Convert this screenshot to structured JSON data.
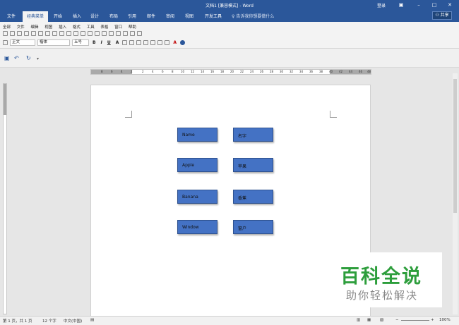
{
  "window": {
    "title": "文档1 [兼容模式] - Word",
    "login": "登录"
  },
  "tabs": [
    "文件",
    "经典菜单",
    "开始",
    "插入",
    "设计",
    "布局",
    "引用",
    "邮件",
    "审阅",
    "视图",
    "开发工具"
  ],
  "tellme": "告诉我你想要做什么",
  "share": "共享",
  "menu": [
    "全部",
    "文件",
    "编辑",
    "视图",
    "插入",
    "格式",
    "工具",
    "表格",
    "窗口",
    "帮助"
  ],
  "toolbar": {
    "style": "正文",
    "font": "楷体",
    "size": "五号",
    "style_alt": "正文"
  },
  "ruler": {
    "left_ticks": [
      "8",
      "6",
      "4",
      "2"
    ],
    "right_ticks": [
      "2",
      "4",
      "6",
      "8",
      "10",
      "12",
      "14",
      "16",
      "18",
      "20",
      "22",
      "24",
      "26",
      "28",
      "30",
      "32",
      "34",
      "36",
      "38",
      "40",
      "42",
      "44",
      "46",
      "48"
    ]
  },
  "boxes": [
    {
      "left": "Name",
      "right": "名字"
    },
    {
      "left": "Apple",
      "right": "苹果"
    },
    {
      "left": "Banana",
      "right": "香蕉"
    },
    {
      "left": "Window",
      "right": "窗户"
    }
  ],
  "status": {
    "page": "第 1 页，共 1 页",
    "words": "12 个字",
    "lang": "中文(中国)",
    "zoom": "100%"
  },
  "watermark": {
    "line1": "百科全说",
    "line2": "助你轻松解决"
  },
  "colors": {
    "accent": "#2b579a",
    "box": "#4472c4",
    "watermark": "#2d9e3c"
  }
}
